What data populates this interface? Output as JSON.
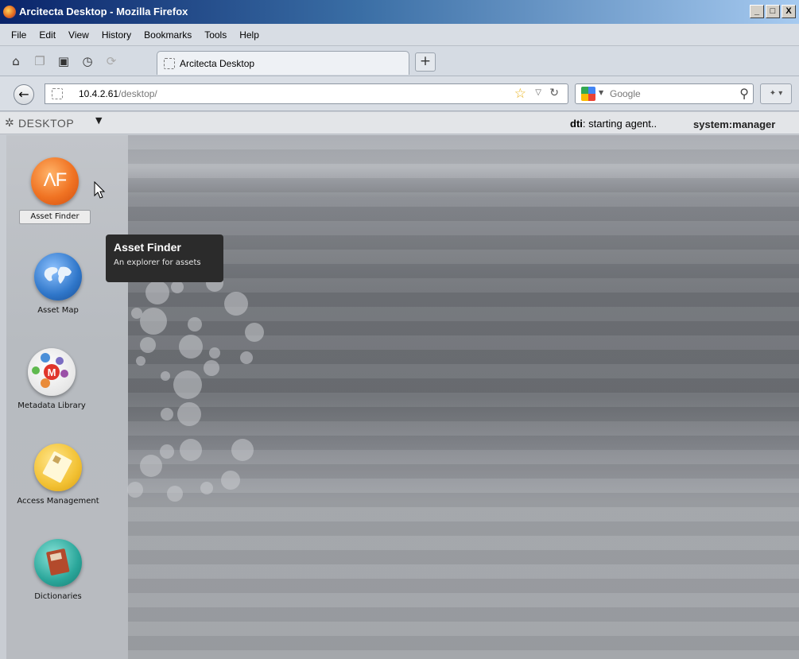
{
  "window": {
    "title": "Arcitecta Desktop - Mozilla Firefox",
    "buttons": {
      "minimize": "_",
      "maximize": "□",
      "close": "X"
    }
  },
  "menu": [
    "File",
    "Edit",
    "View",
    "History",
    "Bookmarks",
    "Tools",
    "Help"
  ],
  "tab": {
    "title": "Arcitecta Desktop",
    "new_tab_label": "+"
  },
  "nav": {
    "back_icon": "back-arrow-icon",
    "url_host": "10.4.2.61",
    "url_path": "/desktop/",
    "search_engine": "Google"
  },
  "desktop_header": {
    "title": "DESKTOP",
    "caret": "▼",
    "status_bold": "dti",
    "status_text": ": starting agent..",
    "user": "system:manager"
  },
  "apps": [
    {
      "label": "Asset Finder",
      "icon": "asset-finder-icon",
      "icon_text": "ΛF",
      "selected": true
    },
    {
      "label": "Asset Map",
      "icon": "globe-icon"
    },
    {
      "label": "Metadata Library",
      "icon": "metadata-library-icon"
    },
    {
      "label": "Access Management",
      "icon": "id-card-icon"
    },
    {
      "label": "Dictionaries",
      "icon": "dictionary-book-icon"
    }
  ],
  "tooltip": {
    "title": "Asset Finder",
    "description": "An explorer for assets"
  },
  "colors": {
    "titlebar_start": "#0a246a",
    "tooltip_bg": "#2b2b2b",
    "asset_finder_orange": "#f07323"
  }
}
